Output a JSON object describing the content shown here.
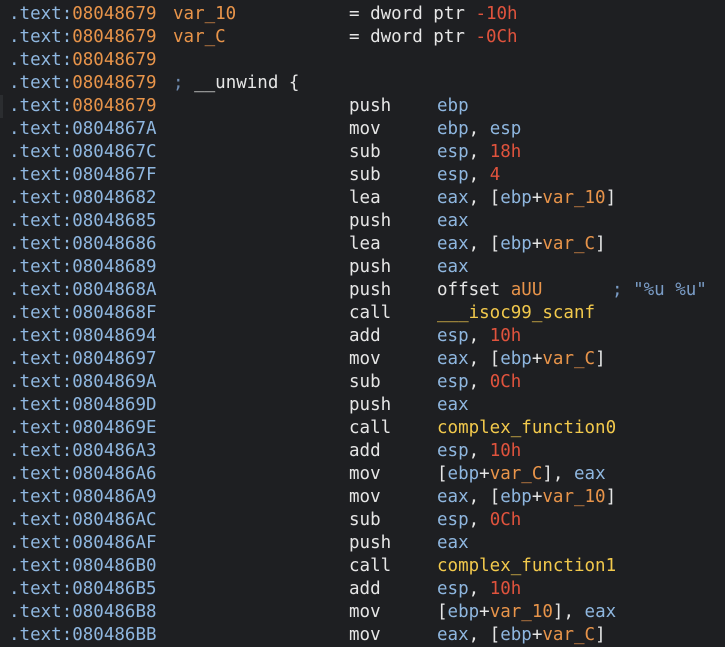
{
  "listing": {
    "segment": ".text",
    "lines": [
      {
        "addr": "08048679",
        "kind": "data",
        "label": "var_10",
        "equ": {
          "text": "= dword ptr ",
          "num": "-10h"
        }
      },
      {
        "addr": "08048679",
        "kind": "data",
        "label": "var_C",
        "equ": {
          "text": "= dword ptr ",
          "num": "-0Ch"
        }
      },
      {
        "addr": "08048679",
        "kind": "data"
      },
      {
        "addr": "08048679",
        "kind": "data",
        "unwind": {
          "semi": ";",
          "text": " __unwind {"
        }
      },
      {
        "addr": "08048679",
        "kind": "data",
        "cursor": true,
        "mnem": "push",
        "ops": [
          {
            "t": "reg",
            "v": "ebp"
          }
        ]
      },
      {
        "addr": "0804867A",
        "kind": "code",
        "mnem": "mov",
        "ops": [
          {
            "t": "reg",
            "v": "ebp"
          },
          {
            "t": "punc",
            "v": ", "
          },
          {
            "t": "reg",
            "v": "esp"
          }
        ]
      },
      {
        "addr": "0804867C",
        "kind": "code",
        "mnem": "sub",
        "ops": [
          {
            "t": "reg",
            "v": "esp"
          },
          {
            "t": "punc",
            "v": ", "
          },
          {
            "t": "num",
            "v": "18h"
          }
        ]
      },
      {
        "addr": "0804867F",
        "kind": "code",
        "mnem": "sub",
        "ops": [
          {
            "t": "reg",
            "v": "esp"
          },
          {
            "t": "punc",
            "v": ", "
          },
          {
            "t": "num",
            "v": "4"
          }
        ]
      },
      {
        "addr": "08048682",
        "kind": "code",
        "mnem": "lea",
        "ops": [
          {
            "t": "reg",
            "v": "eax"
          },
          {
            "t": "punc",
            "v": ", ["
          },
          {
            "t": "reg",
            "v": "ebp"
          },
          {
            "t": "punc",
            "v": "+"
          },
          {
            "t": "var",
            "v": "var_10"
          },
          {
            "t": "punc",
            "v": "]"
          }
        ]
      },
      {
        "addr": "08048685",
        "kind": "code",
        "mnem": "push",
        "ops": [
          {
            "t": "reg",
            "v": "eax"
          }
        ]
      },
      {
        "addr": "08048686",
        "kind": "code",
        "mnem": "lea",
        "ops": [
          {
            "t": "reg",
            "v": "eax"
          },
          {
            "t": "punc",
            "v": ", ["
          },
          {
            "t": "reg",
            "v": "ebp"
          },
          {
            "t": "punc",
            "v": "+"
          },
          {
            "t": "var",
            "v": "var_C"
          },
          {
            "t": "punc",
            "v": "]"
          }
        ]
      },
      {
        "addr": "08048689",
        "kind": "code",
        "mnem": "push",
        "ops": [
          {
            "t": "reg",
            "v": "eax"
          }
        ]
      },
      {
        "addr": "0804868A",
        "kind": "code",
        "mnem": "push",
        "ops": [
          {
            "t": "kw",
            "v": "offset "
          },
          {
            "t": "str",
            "v": "aUU"
          }
        ],
        "comment": "; \"%u %u\""
      },
      {
        "addr": "0804868F",
        "kind": "code",
        "mnem": "call",
        "ops": [
          {
            "t": "func",
            "v": "___isoc99_scanf"
          }
        ]
      },
      {
        "addr": "08048694",
        "kind": "code",
        "mnem": "add",
        "ops": [
          {
            "t": "reg",
            "v": "esp"
          },
          {
            "t": "punc",
            "v": ", "
          },
          {
            "t": "num",
            "v": "10h"
          }
        ]
      },
      {
        "addr": "08048697",
        "kind": "code",
        "mnem": "mov",
        "ops": [
          {
            "t": "reg",
            "v": "eax"
          },
          {
            "t": "punc",
            "v": ", ["
          },
          {
            "t": "reg",
            "v": "ebp"
          },
          {
            "t": "punc",
            "v": "+"
          },
          {
            "t": "var",
            "v": "var_C"
          },
          {
            "t": "punc",
            "v": "]"
          }
        ]
      },
      {
        "addr": "0804869A",
        "kind": "code",
        "mnem": "sub",
        "ops": [
          {
            "t": "reg",
            "v": "esp"
          },
          {
            "t": "punc",
            "v": ", "
          },
          {
            "t": "num",
            "v": "0Ch"
          }
        ]
      },
      {
        "addr": "0804869D",
        "kind": "code",
        "mnem": "push",
        "ops": [
          {
            "t": "reg",
            "v": "eax"
          }
        ]
      },
      {
        "addr": "0804869E",
        "kind": "code",
        "mnem": "call",
        "ops": [
          {
            "t": "func",
            "v": "complex_function0"
          }
        ]
      },
      {
        "addr": "080486A3",
        "kind": "code",
        "mnem": "add",
        "ops": [
          {
            "t": "reg",
            "v": "esp"
          },
          {
            "t": "punc",
            "v": ", "
          },
          {
            "t": "num",
            "v": "10h"
          }
        ]
      },
      {
        "addr": "080486A6",
        "kind": "code",
        "mnem": "mov",
        "ops": [
          {
            "t": "punc",
            "v": "["
          },
          {
            "t": "reg",
            "v": "ebp"
          },
          {
            "t": "punc",
            "v": "+"
          },
          {
            "t": "var",
            "v": "var_C"
          },
          {
            "t": "punc",
            "v": "], "
          },
          {
            "t": "reg",
            "v": "eax"
          }
        ]
      },
      {
        "addr": "080486A9",
        "kind": "code",
        "mnem": "mov",
        "ops": [
          {
            "t": "reg",
            "v": "eax"
          },
          {
            "t": "punc",
            "v": ", ["
          },
          {
            "t": "reg",
            "v": "ebp"
          },
          {
            "t": "punc",
            "v": "+"
          },
          {
            "t": "var",
            "v": "var_10"
          },
          {
            "t": "punc",
            "v": "]"
          }
        ]
      },
      {
        "addr": "080486AC",
        "kind": "code",
        "mnem": "sub",
        "ops": [
          {
            "t": "reg",
            "v": "esp"
          },
          {
            "t": "punc",
            "v": ", "
          },
          {
            "t": "num",
            "v": "0Ch"
          }
        ]
      },
      {
        "addr": "080486AF",
        "kind": "code",
        "mnem": "push",
        "ops": [
          {
            "t": "reg",
            "v": "eax"
          }
        ]
      },
      {
        "addr": "080486B0",
        "kind": "code",
        "mnem": "call",
        "ops": [
          {
            "t": "func",
            "v": "complex_function1"
          }
        ]
      },
      {
        "addr": "080486B5",
        "kind": "code",
        "mnem": "add",
        "ops": [
          {
            "t": "reg",
            "v": "esp"
          },
          {
            "t": "punc",
            "v": ", "
          },
          {
            "t": "num",
            "v": "10h"
          }
        ]
      },
      {
        "addr": "080486B8",
        "kind": "code",
        "mnem": "mov",
        "ops": [
          {
            "t": "punc",
            "v": "["
          },
          {
            "t": "reg",
            "v": "ebp"
          },
          {
            "t": "punc",
            "v": "+"
          },
          {
            "t": "var",
            "v": "var_10"
          },
          {
            "t": "punc",
            "v": "], "
          },
          {
            "t": "reg",
            "v": "eax"
          }
        ]
      },
      {
        "addr": "080486BB",
        "kind": "code",
        "mnem": "mov",
        "ops": [
          {
            "t": "reg",
            "v": "eax"
          },
          {
            "t": "punc",
            "v": ", ["
          },
          {
            "t": "reg",
            "v": "ebp"
          },
          {
            "t": "punc",
            "v": "+"
          },
          {
            "t": "var",
            "v": "var_C"
          },
          {
            "t": "punc",
            "v": "]"
          }
        ]
      }
    ]
  },
  "colors": {
    "background": "#1e1f22",
    "address_code": "#8fb7e0",
    "address_data": "#e8944a",
    "register": "#8fb7e0",
    "number": "#e0533d",
    "variable": "#e8944a",
    "function": "#f2c94c",
    "text": "#e6e6e6",
    "comment": "#7a9cc6"
  }
}
